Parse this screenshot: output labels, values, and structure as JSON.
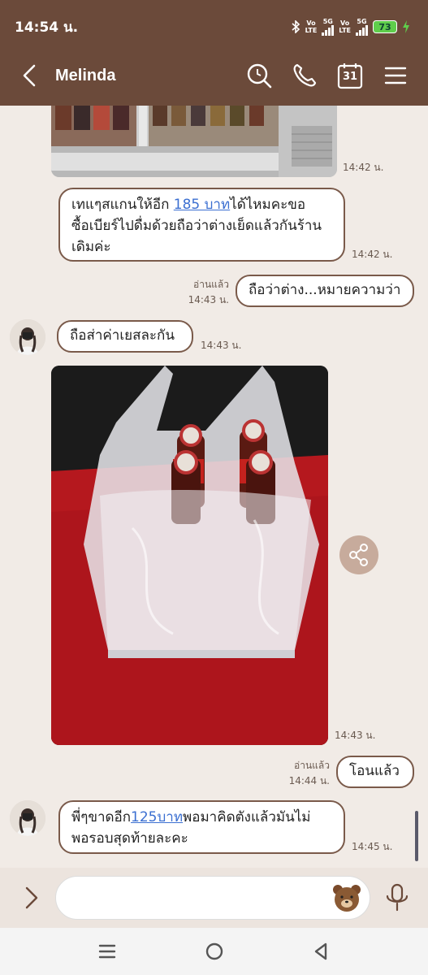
{
  "status_bar": {
    "time": "14:54 น.",
    "signal1_top": "Vo",
    "signal1_bottom": "LTE",
    "net1": "5G",
    "signal2_top": "Vo",
    "signal2_bottom": "LTE",
    "net2": "5G",
    "battery": "73"
  },
  "header": {
    "contact_name": "Melinda",
    "calendar_day": "31"
  },
  "messages": [
    {
      "type": "image",
      "side": "in",
      "content": "fridge photo (partial)",
      "time": "14:42 น."
    },
    {
      "type": "text",
      "side": "in",
      "line1_pre": "เทแๆสแกนให้อีก ",
      "line1_link": "185 บาท",
      "line1_post": "ได้ไหมคะขอ",
      "line2": "ซื้อเบียร์ไปดื่มด้วยถือว่าต่างเย็ดแล้วกันร้าน",
      "line3": "เดิมค่ะ",
      "time": "14:42 น."
    },
    {
      "type": "text",
      "side": "out",
      "text": "ถือว่าต่าง...หมายความว่า",
      "read": "อ่านแล้ว",
      "time": "14:43 น."
    },
    {
      "type": "text",
      "side": "in",
      "text": "ถือส่าค่าเยสละกัน",
      "time": "14:43 น."
    },
    {
      "type": "image",
      "side": "in",
      "content": "beer bottles in plastic bag",
      "time": "14:43 น."
    },
    {
      "type": "text",
      "side": "out",
      "text": "โอนแล้ว",
      "read": "อ่านแล้ว",
      "time": "14:44 น."
    },
    {
      "type": "text",
      "side": "in",
      "line1_pre": "พี่ๆขาดอีก",
      "line1_link": "125บาท",
      "line1_post": "พอมาคิดตังแล้วมันไม่",
      "line2": "พอรอบสุดท้ายละคะ",
      "time": "14:45 น."
    }
  ],
  "input": {
    "placeholder": ""
  },
  "colors": {
    "header_bg": "#6b4a3a",
    "chat_bg": "#f1ebe6",
    "bubble_border": "#7a5a4a",
    "link": "#3b6fd1",
    "share_button": "#c7ab9c"
  },
  "icons": [
    "back-icon",
    "search-icon",
    "phone-icon",
    "calendar-icon",
    "menu-icon",
    "share-icon",
    "expand-icon",
    "sticker-icon",
    "mic-icon",
    "recent-apps-icon",
    "home-icon",
    "nav-back-icon"
  ]
}
